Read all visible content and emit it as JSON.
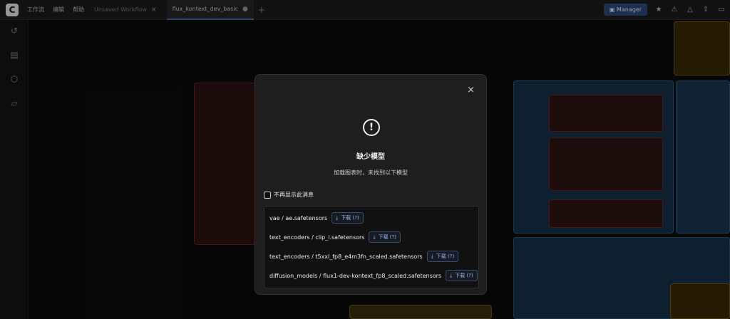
{
  "app": {
    "logo": "C",
    "menu": [
      "工作流",
      "编辑",
      "帮助"
    ],
    "tabs": [
      {
        "label": "Unsaved Workflow",
        "close": "×",
        "active": false
      },
      {
        "label": "flux_kontext_dev_basic",
        "close": "●",
        "active": true
      }
    ],
    "new_tab": "+"
  },
  "toolbar": {
    "manager_label": "Manager",
    "icons": [
      "star-icon",
      "alert-icon",
      "alert-outline-icon",
      "share-icon",
      "window-icon"
    ]
  },
  "sidebar": {
    "icons": [
      "history-icon",
      "node-library-icon",
      "model-library-icon",
      "workflows-icon"
    ]
  },
  "modal": {
    "close": "×",
    "icon": "!",
    "title": "缺少模型",
    "subtitle": "加载图表时，未找到以下模型",
    "dont_show_label": "不再显示此消息",
    "models": [
      {
        "name": "vae / ae.safetensors",
        "button": "下载 (?)"
      },
      {
        "name": "text_encoders / clip_l.safetensors",
        "button": "下载 (?)"
      },
      {
        "name": "text_encoders / t5xxl_fp8_e4m3fn_scaled.safetensors",
        "button": "下载 (?)"
      },
      {
        "name": "diffusion_models / flux1-dev-kontext_fp8_scaled.safetensors",
        "button": "下载 (?)"
      }
    ]
  },
  "colors": {
    "manager": "#2e4a7a",
    "group_blue": "#1f3d5c",
    "group_red": "#4a1a1a",
    "note_yellow": "#4a3a12"
  }
}
